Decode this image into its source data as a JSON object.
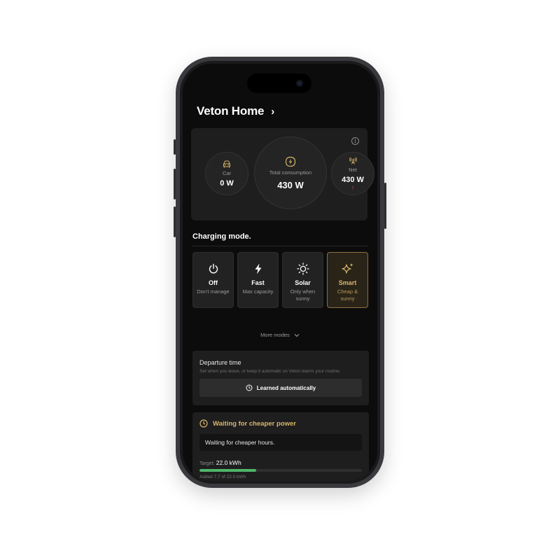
{
  "header": {
    "title": "Veton Home",
    "chevron": "›"
  },
  "energy": {
    "car": {
      "label": "Car",
      "value": "0 W",
      "icon": "car-icon"
    },
    "total": {
      "label": "Total consumption",
      "value": "430 W",
      "icon": "bolt-leaf-icon"
    },
    "net": {
      "label": "Net",
      "value": "430 W",
      "icon": "antenna-icon",
      "direction_arrow": "↑"
    }
  },
  "charging": {
    "title": "Charging mode.",
    "modes": [
      {
        "name": "Off",
        "sub": "Don't manage",
        "icon": "power-icon",
        "active": false
      },
      {
        "name": "Fast",
        "sub": "Max capacity",
        "icon": "bolt-icon",
        "active": false
      },
      {
        "name": "Solar",
        "sub": "Only when sunny",
        "icon": "sun-icon",
        "active": false
      },
      {
        "name": "Smart",
        "sub": "Cheap & sunny",
        "icon": "sparkles-icon",
        "active": true
      }
    ],
    "more_modes": "More modes"
  },
  "departure": {
    "title": "Departure time",
    "subtitle": "Set when you leave, or keep it automatic so Veton learns your routine.",
    "button": "Learned automatically"
  },
  "status": {
    "title": "Waiting for cheaper power",
    "message": "Waiting for cheaper hours.",
    "target_label": "Target:",
    "target_value": "22.0 kWh",
    "progress_fraction": 0.35,
    "added_text": "Added 7.7 of 22.0 kWh"
  },
  "colors": {
    "accent_gold": "#d9b56c",
    "progress_green": "#4fb56a",
    "net_arrow_red": "#d04a4a"
  }
}
